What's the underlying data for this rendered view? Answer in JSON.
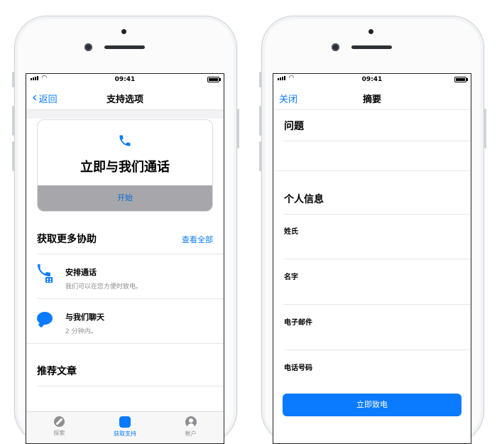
{
  "left_phone": {
    "status": {
      "time": "09:41"
    },
    "nav": {
      "back_label": "返回",
      "title": "支持选项"
    },
    "call_card": {
      "title": "立即与我们通话",
      "start_label": "开始",
      "icon": "phone-icon"
    },
    "more_help": {
      "heading": "获取更多协助",
      "see_all": "查看全部",
      "items": [
        {
          "title": "安排通话",
          "subtitle": "我们可以在您方便时致电。",
          "icon": "schedule-call-icon"
        },
        {
          "title": "与我们聊天",
          "subtitle": "2 分钟内。",
          "icon": "chat-bubble-icon"
        }
      ]
    },
    "recommended": {
      "heading": "推荐文章"
    },
    "tabbar": {
      "tabs": [
        {
          "label": "探索",
          "icon": "compass-icon"
        },
        {
          "label": "获取支持",
          "icon": "support-icon"
        },
        {
          "label": "帐户",
          "icon": "account-icon"
        }
      ]
    }
  },
  "right_phone": {
    "status": {
      "time": "09:41"
    },
    "nav": {
      "close_label": "关闭",
      "title": "摘要"
    },
    "problem": {
      "heading": "问题"
    },
    "personal_info": {
      "heading": "个人信息",
      "fields": [
        {
          "label": "姓氏"
        },
        {
          "label": "名字"
        },
        {
          "label": "电子邮件"
        },
        {
          "label": "电话号码"
        }
      ]
    },
    "call_button": {
      "label": "立即致电"
    }
  },
  "colors": {
    "accent": "#0a7aff",
    "start_bar": "#a7a7ab",
    "separator": "#e6e6e8"
  }
}
